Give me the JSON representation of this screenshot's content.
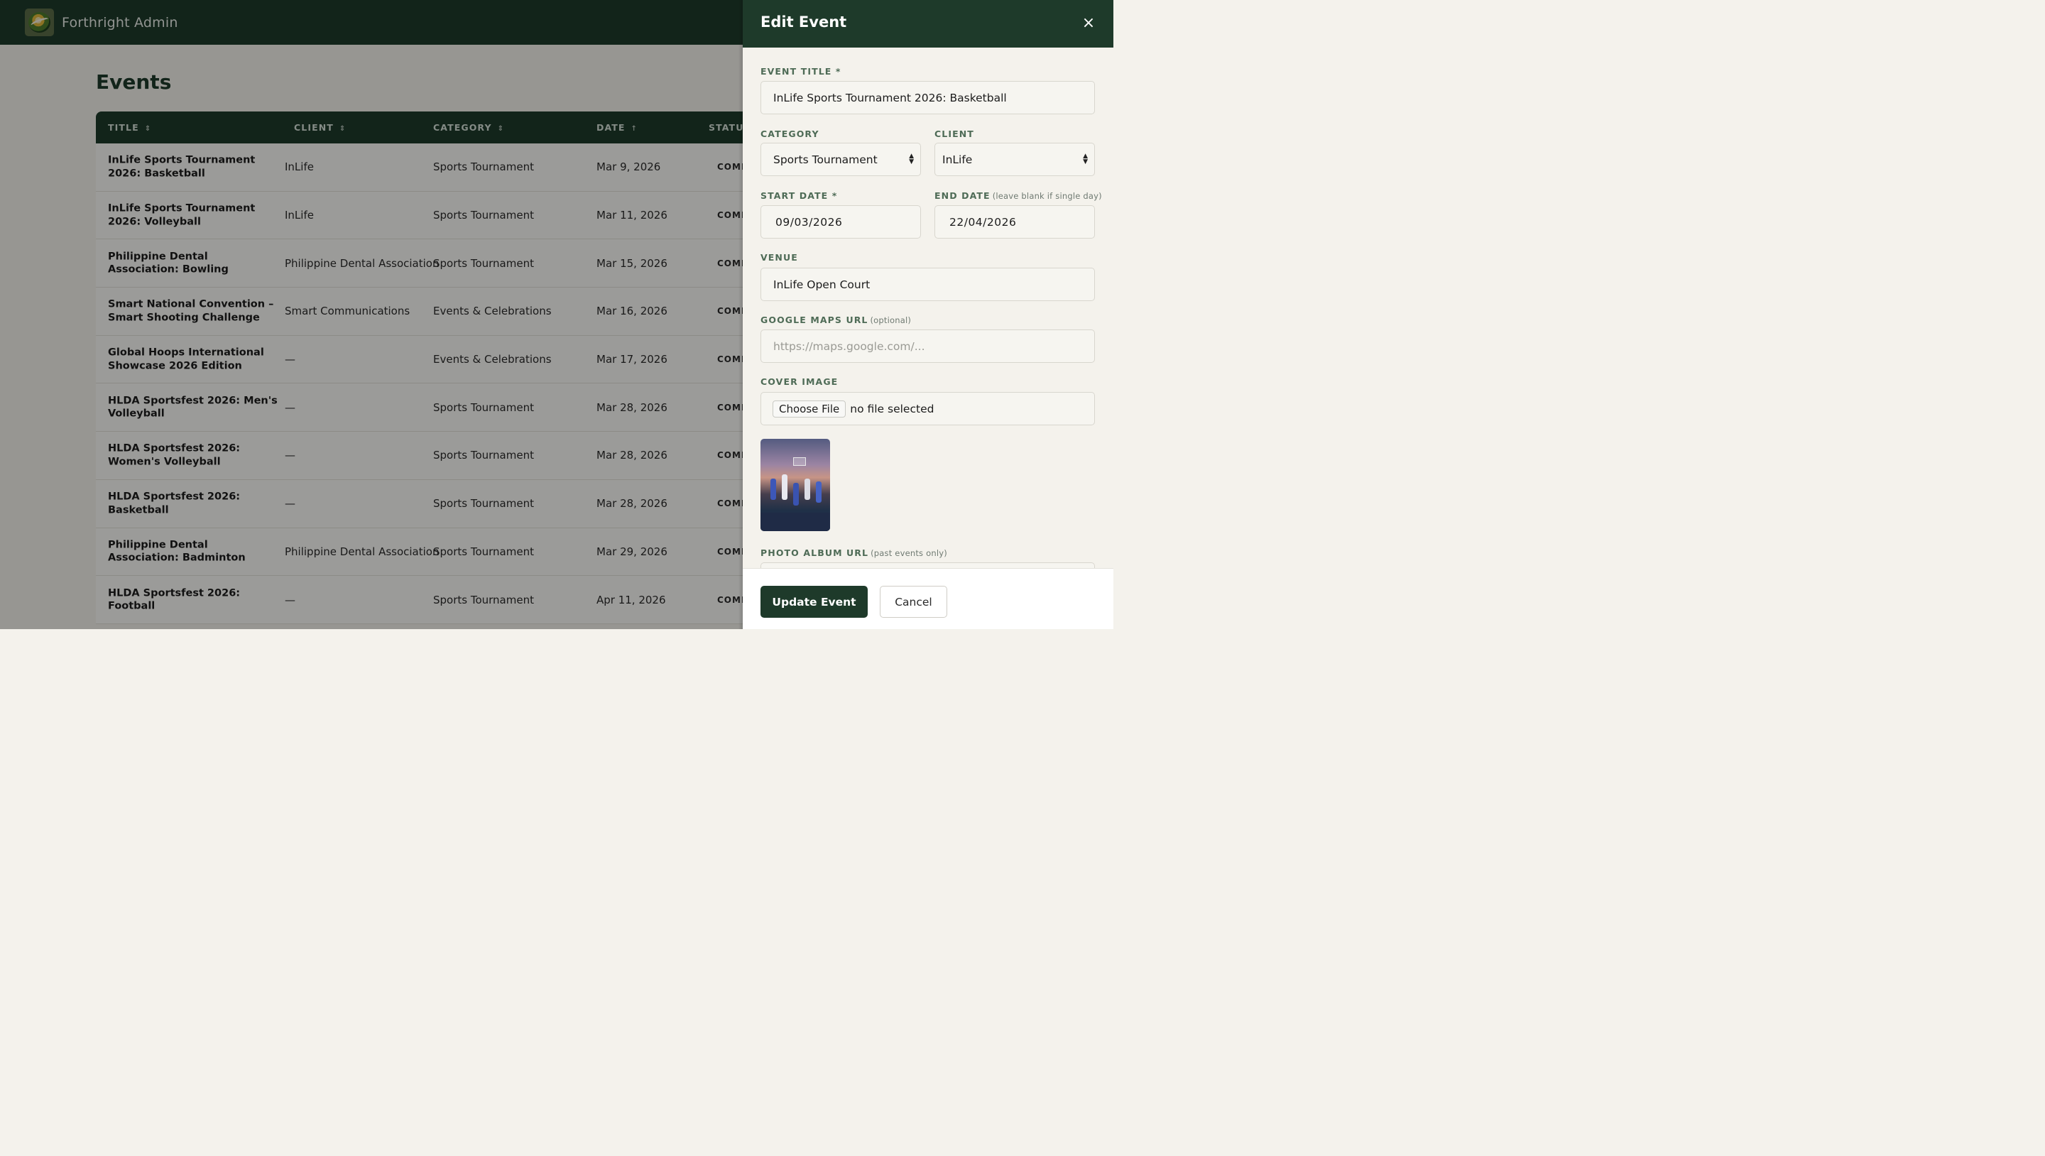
{
  "app": {
    "brand": "Forthright Admin"
  },
  "page": {
    "title": "Events"
  },
  "table": {
    "columns": [
      {
        "label": "TITLE",
        "sort": "⇕"
      },
      {
        "label": "CLIENT",
        "sort": "⇕"
      },
      {
        "label": "CATEGORY",
        "sort": "⇕"
      },
      {
        "label": "DATE",
        "sort": "↑"
      },
      {
        "label": "STATUS",
        "sort": ""
      }
    ],
    "rows": [
      {
        "title": "InLife Sports Tournament 2026: Basketball",
        "client": "InLife",
        "category": "Sports Tournament",
        "date": "Mar 9, 2026",
        "status": "COMPLETED"
      },
      {
        "title": "InLife Sports Tournament 2026: Volleyball",
        "client": "InLife",
        "category": "Sports Tournament",
        "date": "Mar 11, 2026",
        "status": "COMPLETED"
      },
      {
        "title": "Philippine Dental Association: Bowling",
        "client": "Philippine Dental Association",
        "category": "Sports Tournament",
        "date": "Mar 15, 2026",
        "status": "COMPLETED"
      },
      {
        "title": "Smart National Convention – Smart Shooting Challenge",
        "client": "Smart Communications",
        "category": "Events & Celebrations",
        "date": "Mar 16, 2026",
        "status": "COMPLETED"
      },
      {
        "title": "Global Hoops International Showcase 2026 Edition",
        "client": "—",
        "category": "Events & Celebrations",
        "date": "Mar 17, 2026",
        "status": "COMPLETED"
      },
      {
        "title": "HLDA Sportsfest 2026: Men's Volleyball",
        "client": "—",
        "category": "Sports Tournament",
        "date": "Mar 28, 2026",
        "status": "COMPLETED"
      },
      {
        "title": "HLDA Sportsfest 2026: Women's Volleyball",
        "client": "—",
        "category": "Sports Tournament",
        "date": "Mar 28, 2026",
        "status": "COMPLETED"
      },
      {
        "title": "HLDA Sportsfest 2026: Basketball",
        "client": "—",
        "category": "Sports Tournament",
        "date": "Mar 28, 2026",
        "status": "COMPLETED"
      },
      {
        "title": "Philippine Dental Association: Badminton",
        "client": "Philippine Dental Association",
        "category": "Sports Tournament",
        "date": "Mar 29, 2026",
        "status": "COMPLETED"
      },
      {
        "title": "HLDA Sportsfest 2026: Football",
        "client": "—",
        "category": "Sports Tournament",
        "date": "Apr 11, 2026",
        "status": "COMPLETED"
      }
    ]
  },
  "drawer": {
    "title": "Edit Event",
    "close": "×",
    "event_title_label": "EVENT TITLE *",
    "event_title_value": "InLife Sports Tournament 2026: Basketball",
    "category_label": "CATEGORY",
    "category_value": "Sports Tournament",
    "client_label": "CLIENT",
    "client_value": "InLife",
    "start_date_label": "START DATE *",
    "start_date_value": "09/03/2026",
    "end_date_label": "END DATE",
    "end_date_hint": "(leave blank if single day)",
    "end_date_value": "22/04/2026",
    "venue_label": "VENUE",
    "venue_value": "InLife Open Court",
    "maps_label": "GOOGLE MAPS URL",
    "maps_hint": "(optional)",
    "maps_placeholder": "https://maps.google.com/...",
    "cover_label": "COVER IMAGE",
    "choose_file": "Choose File",
    "no_file": "no file selected",
    "album_label": "PHOTO ALBUM URL",
    "album_hint": "(past events only)",
    "update_button": "Update Event",
    "cancel_button": "Cancel"
  },
  "colors": {
    "primary": "#1e3a2a",
    "label": "#4e6b56",
    "field_bg": "#f6f5f0"
  }
}
